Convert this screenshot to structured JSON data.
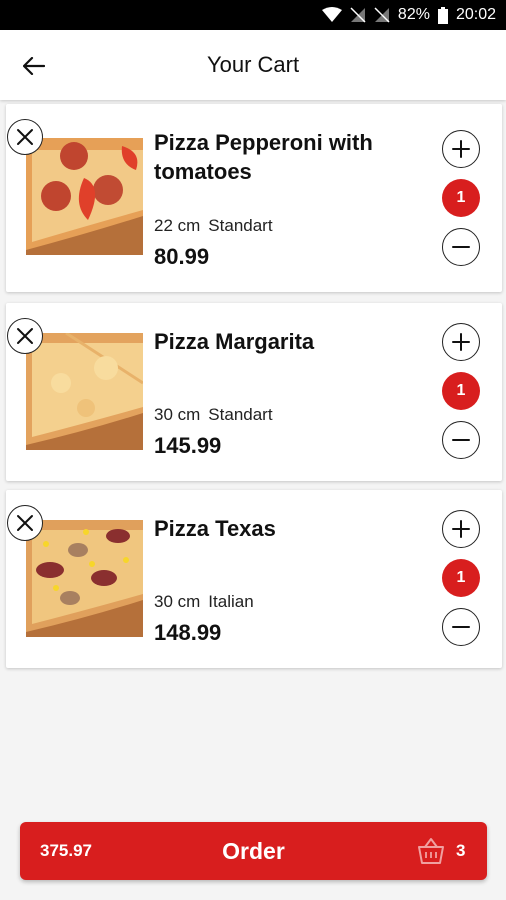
{
  "status_bar": {
    "battery": "82%",
    "time": "20:02"
  },
  "header": {
    "title": "Your Cart"
  },
  "cart": {
    "items": [
      {
        "name": "Pizza Pepperoni with tomatoes",
        "size": "22 cm",
        "dough": "Standart",
        "price": "80.99",
        "quantity": "1"
      },
      {
        "name": "Pizza Margarita",
        "size": "30 cm",
        "dough": "Standart",
        "price": "145.99",
        "quantity": "1"
      },
      {
        "name": "Pizza Texas",
        "size": "30 cm",
        "dough": "Italian",
        "price": "148.99",
        "quantity": "1"
      }
    ]
  },
  "order_bar": {
    "total": "375.97",
    "label": "Order",
    "count": "3"
  },
  "colors": {
    "accent": "#d81e1e",
    "background": "#f4f4f4"
  },
  "icons": [
    "back-arrow-icon",
    "close-icon",
    "plus-icon",
    "minus-icon",
    "basket-icon",
    "wifi-icon",
    "signal-icon",
    "battery-icon"
  ]
}
